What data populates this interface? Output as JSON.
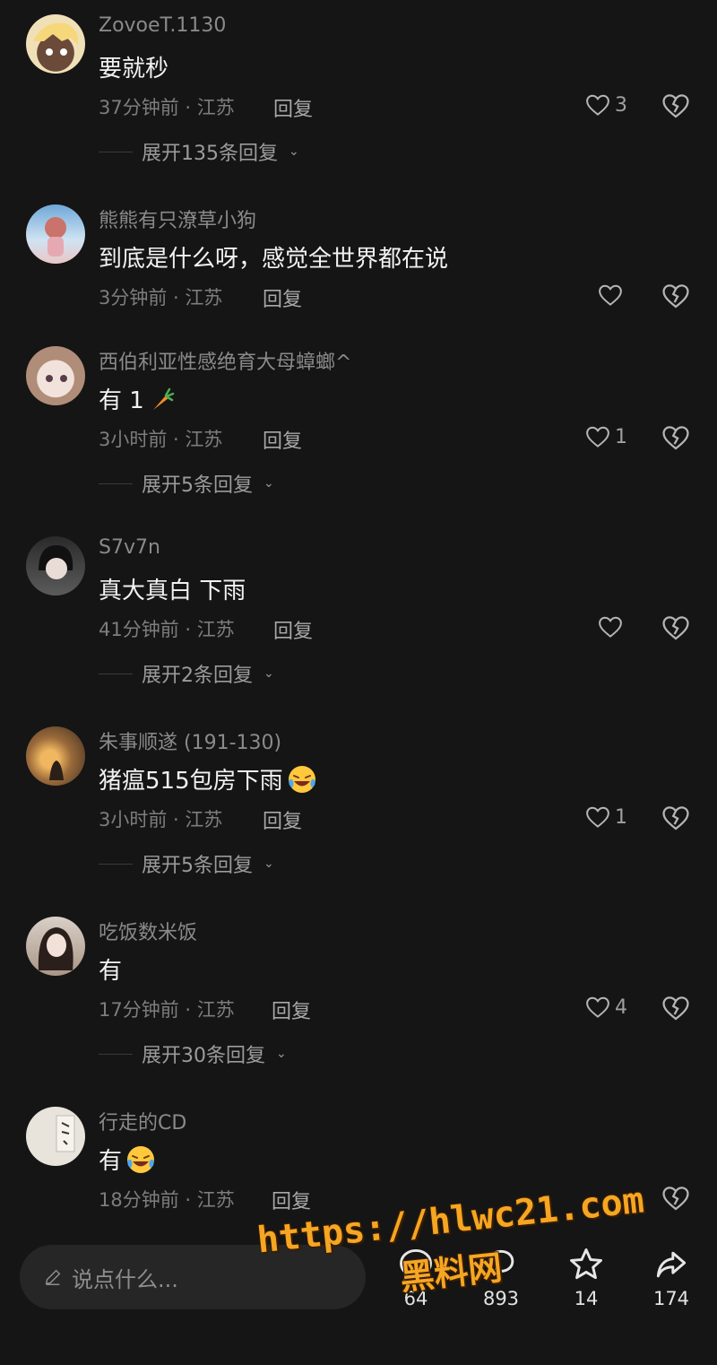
{
  "comments": [
    {
      "username": "ZovoeT.1130",
      "text": "要就秒",
      "time": "37分钟前 · 江苏",
      "reply": "回复",
      "likes": "3",
      "expand": "展开135条回复"
    },
    {
      "username": "熊熊有只潦草小狗",
      "text": "到底是什么呀，感觉全世界都在说",
      "time": "3分钟前 · 江苏",
      "reply": "回复",
      "likes": "",
      "expand": ""
    },
    {
      "username": "西伯利亚性感绝育大母蟑螂^",
      "text": "有 1",
      "time": "3小时前 · 江苏",
      "reply": "回复",
      "likes": "1",
      "expand": "展开5条回复"
    },
    {
      "username": "S7v7n",
      "text": "真大真白 下雨",
      "time": "41分钟前 · 江苏",
      "reply": "回复",
      "likes": "",
      "expand": "展开2条回复"
    },
    {
      "username": "朱事顺遂 (191-130)",
      "text": "猪瘟515包房下雨",
      "time": "3小时前 · 江苏",
      "reply": "回复",
      "likes": "1",
      "expand": "展开5条回复"
    },
    {
      "username": "吃饭数米饭",
      "text": "有",
      "time": "17分钟前 · 江苏",
      "reply": "回复",
      "likes": "4",
      "expand": "展开30条回复"
    },
    {
      "username": "行走的CD",
      "text": "有",
      "time": "18分钟前 · 江苏",
      "reply": "回复",
      "likes": "",
      "expand": ""
    }
  ],
  "bottom": {
    "input_placeholder": "说点什么...",
    "comments_count": "64",
    "reposts_count": "893",
    "favorites_count": "14",
    "shares_count": "174"
  },
  "watermark": {
    "url": "https://hlwc21.com",
    "label": "黑料网"
  },
  "icons": {
    "like": "heart-outline-icon",
    "dislike": "broken-heart-icon",
    "edit": "pencil-icon",
    "comment": "comment-bubble-icon",
    "repost": "repost-icon",
    "favorite": "star-outline-icon",
    "share": "share-arrow-icon"
  },
  "colors": {
    "background": "#151515",
    "watermark": "#f5a623"
  }
}
